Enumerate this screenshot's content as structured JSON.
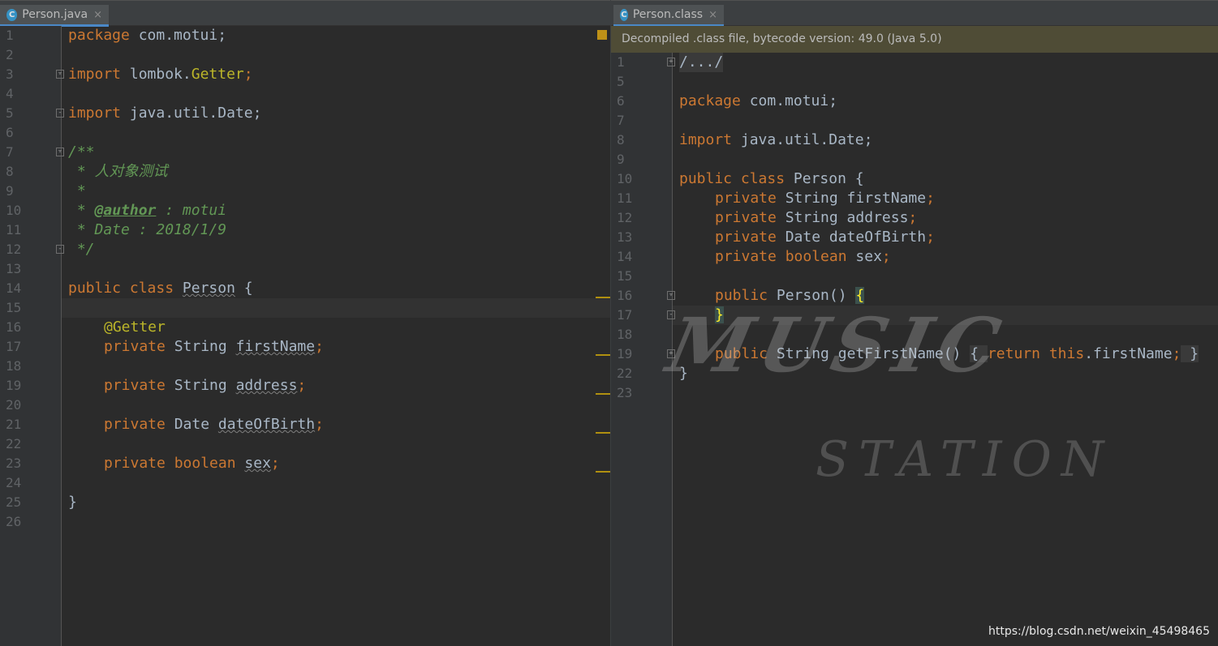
{
  "left": {
    "tab": {
      "icon": "C",
      "label": "Person.java",
      "close": "×"
    },
    "lines": [
      {
        "n": "1"
      },
      {
        "n": "2"
      },
      {
        "n": "3"
      },
      {
        "n": "4"
      },
      {
        "n": "5"
      },
      {
        "n": "6"
      },
      {
        "n": "7"
      },
      {
        "n": "8"
      },
      {
        "n": "9"
      },
      {
        "n": "10"
      },
      {
        "n": "11"
      },
      {
        "n": "12"
      },
      {
        "n": "13"
      },
      {
        "n": "14"
      },
      {
        "n": "15"
      },
      {
        "n": "16"
      },
      {
        "n": "17"
      },
      {
        "n": "18"
      },
      {
        "n": "19"
      },
      {
        "n": "20"
      },
      {
        "n": "21"
      },
      {
        "n": "22"
      },
      {
        "n": "23"
      },
      {
        "n": "24"
      },
      {
        "n": "25"
      },
      {
        "n": "26"
      }
    ],
    "code": {
      "l1_kw": "package",
      "l1_rest": " com.motui;",
      "l3_kw": "import",
      "l3_pkg": " lombok.",
      "l3_ann": "Getter",
      "l3_semi": ";",
      "l5_kw": "import",
      "l5_rest": " java.util.Date;",
      "l7": "/**",
      "l8": " * 人对象测试",
      "l9": " *",
      "l10_pre": " * ",
      "l10_tag": "@author",
      "l10_rest": " : motui",
      "l11": " * Date : 2018/1/9",
      "l12": " */",
      "l14_kw": "public class",
      "l14_sp": " ",
      "l14_name": "Person",
      "l14_rest": " {",
      "l16_ann": "@Getter",
      "l17_kw": "private",
      "l17_type": " String ",
      "l17_name": "firstName",
      "l17_semi": ";",
      "l19_kw": "private",
      "l19_type": " String ",
      "l19_name": "address",
      "l19_semi": ";",
      "l21_kw": "private",
      "l21_type": " Date ",
      "l21_name": "dateOfBirth",
      "l21_semi": ";",
      "l23_kw": "private boolean",
      "l23_sp": " ",
      "l23_name": "sex",
      "l23_semi": ";",
      "l25": "}"
    }
  },
  "right": {
    "tab": {
      "icon": "C",
      "label": "Person.class",
      "close": "×"
    },
    "infobar": "Decompiled .class file, bytecode version: 49.0 (Java 5.0)",
    "lines": [
      {
        "n": "1"
      },
      {
        "n": "5"
      },
      {
        "n": "6"
      },
      {
        "n": "7"
      },
      {
        "n": "8"
      },
      {
        "n": "9"
      },
      {
        "n": "10"
      },
      {
        "n": "11"
      },
      {
        "n": "12"
      },
      {
        "n": "13"
      },
      {
        "n": "14"
      },
      {
        "n": "15"
      },
      {
        "n": "16"
      },
      {
        "n": "17"
      },
      {
        "n": "18"
      },
      {
        "n": "19"
      },
      {
        "n": "22"
      },
      {
        "n": "23"
      }
    ],
    "code": {
      "r1": "/.../",
      "r6_kw": "package",
      "r6_rest": " com.motui;",
      "r8_kw": "import",
      "r8_rest": " java.util.Date;",
      "r10_kw": "public class",
      "r10_rest": " Person {",
      "r11_kw": "private",
      "r11_rest": " String firstName",
      "r12_kw": "private",
      "r12_rest": " String address",
      "r13_kw": "private",
      "r13_rest": " Date dateOfBirth",
      "r14_kw": "private boolean",
      "r14_rest": " sex",
      "semi": ";",
      "r16_kw": "public",
      "r16_rest": " Person() ",
      "r16_brace": "{",
      "r17_brace": "}",
      "r19_kw": "public",
      "r19_rest": " String getFirstName() ",
      "r19_fold_open": "{ ",
      "r19_ret": "return this",
      "r19_field": ".firstName",
      "r19_fold_close": " }",
      "r22": "}"
    }
  },
  "watermark": {
    "line1": "MUSIC",
    "line2": "STATION"
  },
  "footer_url": "https://blog.csdn.net/weixin_45498465"
}
